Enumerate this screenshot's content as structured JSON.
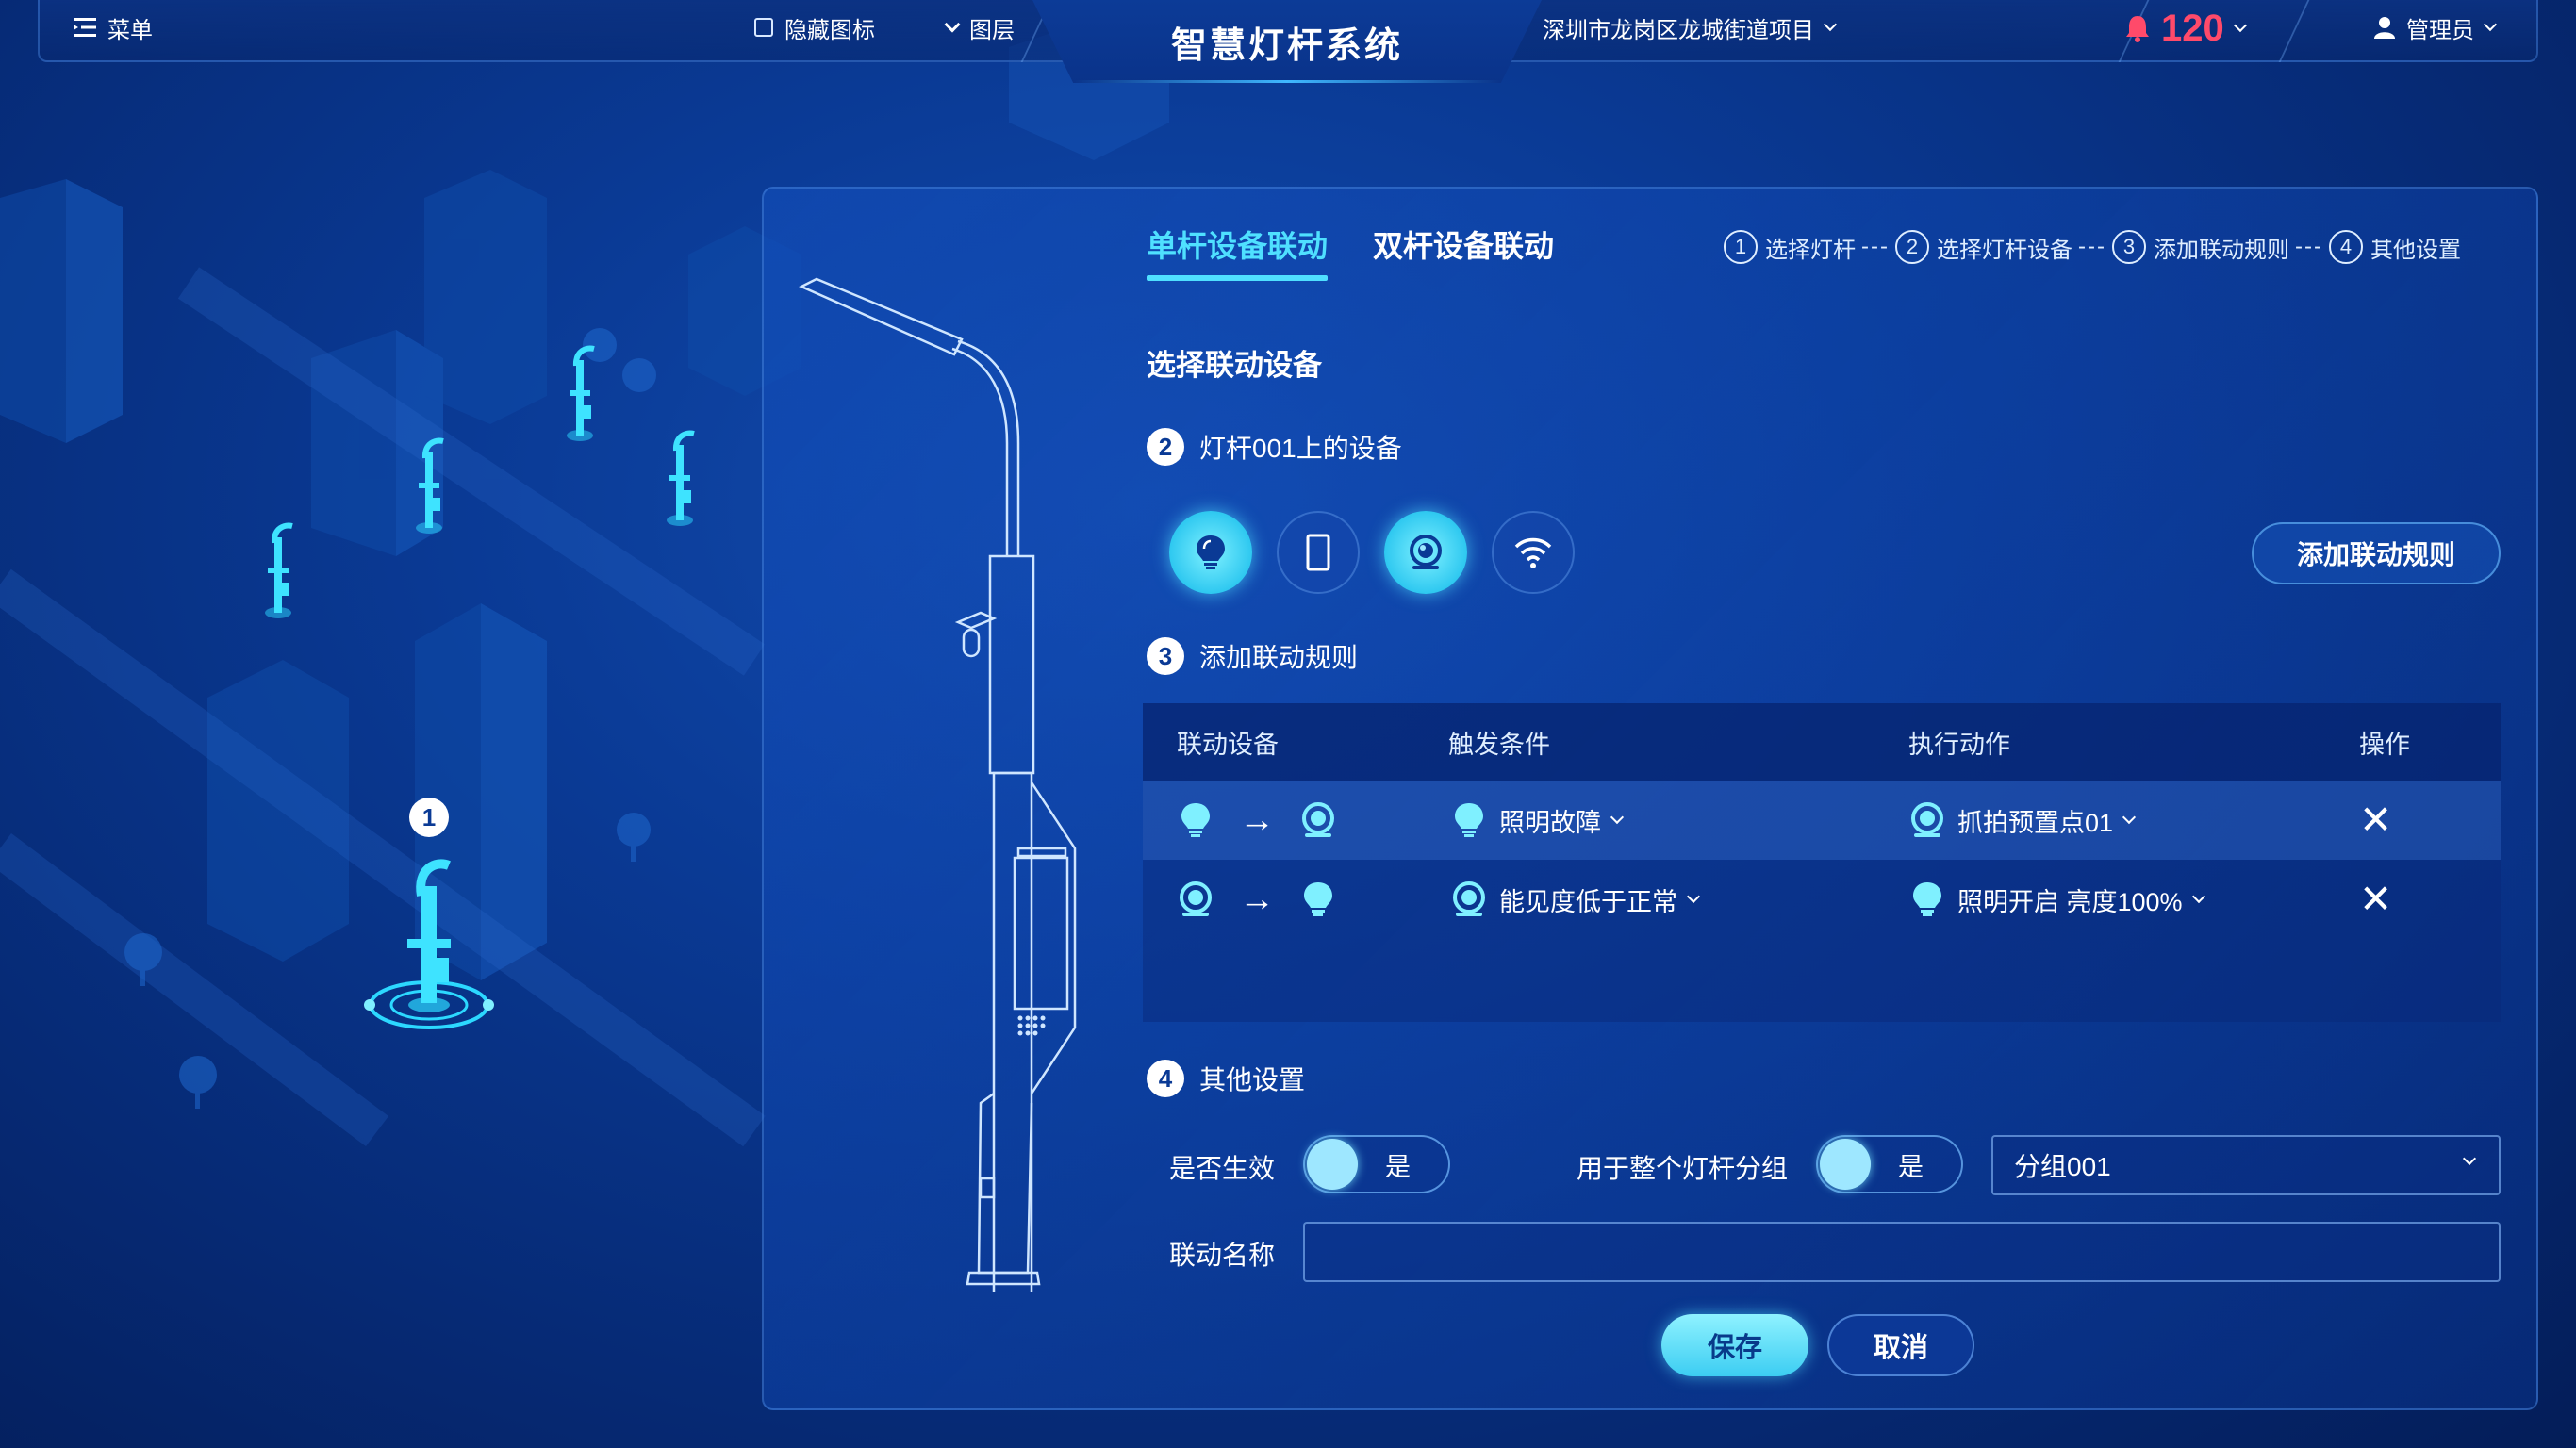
{
  "app": {
    "title": "智慧灯杆系统"
  },
  "topbar": {
    "menu_label": "菜单",
    "hide_icons_label": "隐藏图标",
    "layers_label": "图层",
    "project_label": "深圳市龙岗区龙城街道项目",
    "alert_count": "120",
    "user_label": "管理员"
  },
  "map": {
    "selected_badge": "1"
  },
  "tabs": [
    {
      "label": "单杆设备联动",
      "active": true
    },
    {
      "label": "双杆设备联动",
      "active": false
    }
  ],
  "steps": [
    {
      "num": "1",
      "label": "选择灯杆"
    },
    {
      "num": "2",
      "label": "选择灯杆设备"
    },
    {
      "num": "3",
      "label": "添加联动规则"
    },
    {
      "num": "4",
      "label": "其他设置"
    }
  ],
  "step_dash": "---",
  "panel": {
    "section_title": "选择联动设备",
    "sec2": {
      "num": "2",
      "label": "灯杆001上的设备"
    },
    "devices": [
      {
        "icon": "bulb-icon",
        "active": true
      },
      {
        "icon": "screen-icon",
        "active": false
      },
      {
        "icon": "camera-icon",
        "active": true
      },
      {
        "icon": "wifi-icon",
        "active": false
      }
    ],
    "add_rule_label": "添加联动规则",
    "sec3": {
      "num": "3",
      "label": "添加联动规则"
    },
    "table": {
      "headers": [
        "联动设备",
        "触发条件",
        "执行动作",
        "操作"
      ],
      "rows": [
        {
          "from": "bulb-icon",
          "to": "camera-icon",
          "trigger_icon": "bulb-icon",
          "trigger": "照明故障",
          "action_icon": "camera-icon",
          "action": "抓拍预置点01"
        },
        {
          "from": "camera-icon",
          "to": "bulb-icon",
          "trigger_icon": "camera-icon",
          "trigger": "能见度低于正常",
          "action_icon": "bulb-icon",
          "action": "照明开启 亮度100%"
        }
      ]
    },
    "sec4": {
      "num": "4",
      "label": "其他设置"
    },
    "effective_label": "是否生效",
    "effective_value": "是",
    "group_label": "用于整个灯杆分组",
    "group_toggle_value": "是",
    "group_select": "分组001",
    "name_label": "联动名称",
    "name_value": "",
    "save_label": "保存",
    "cancel_label": "取消"
  },
  "colors": {
    "accent": "#4fe0ff",
    "alert": "#ff4a6a",
    "bg": "#0a3a95"
  }
}
